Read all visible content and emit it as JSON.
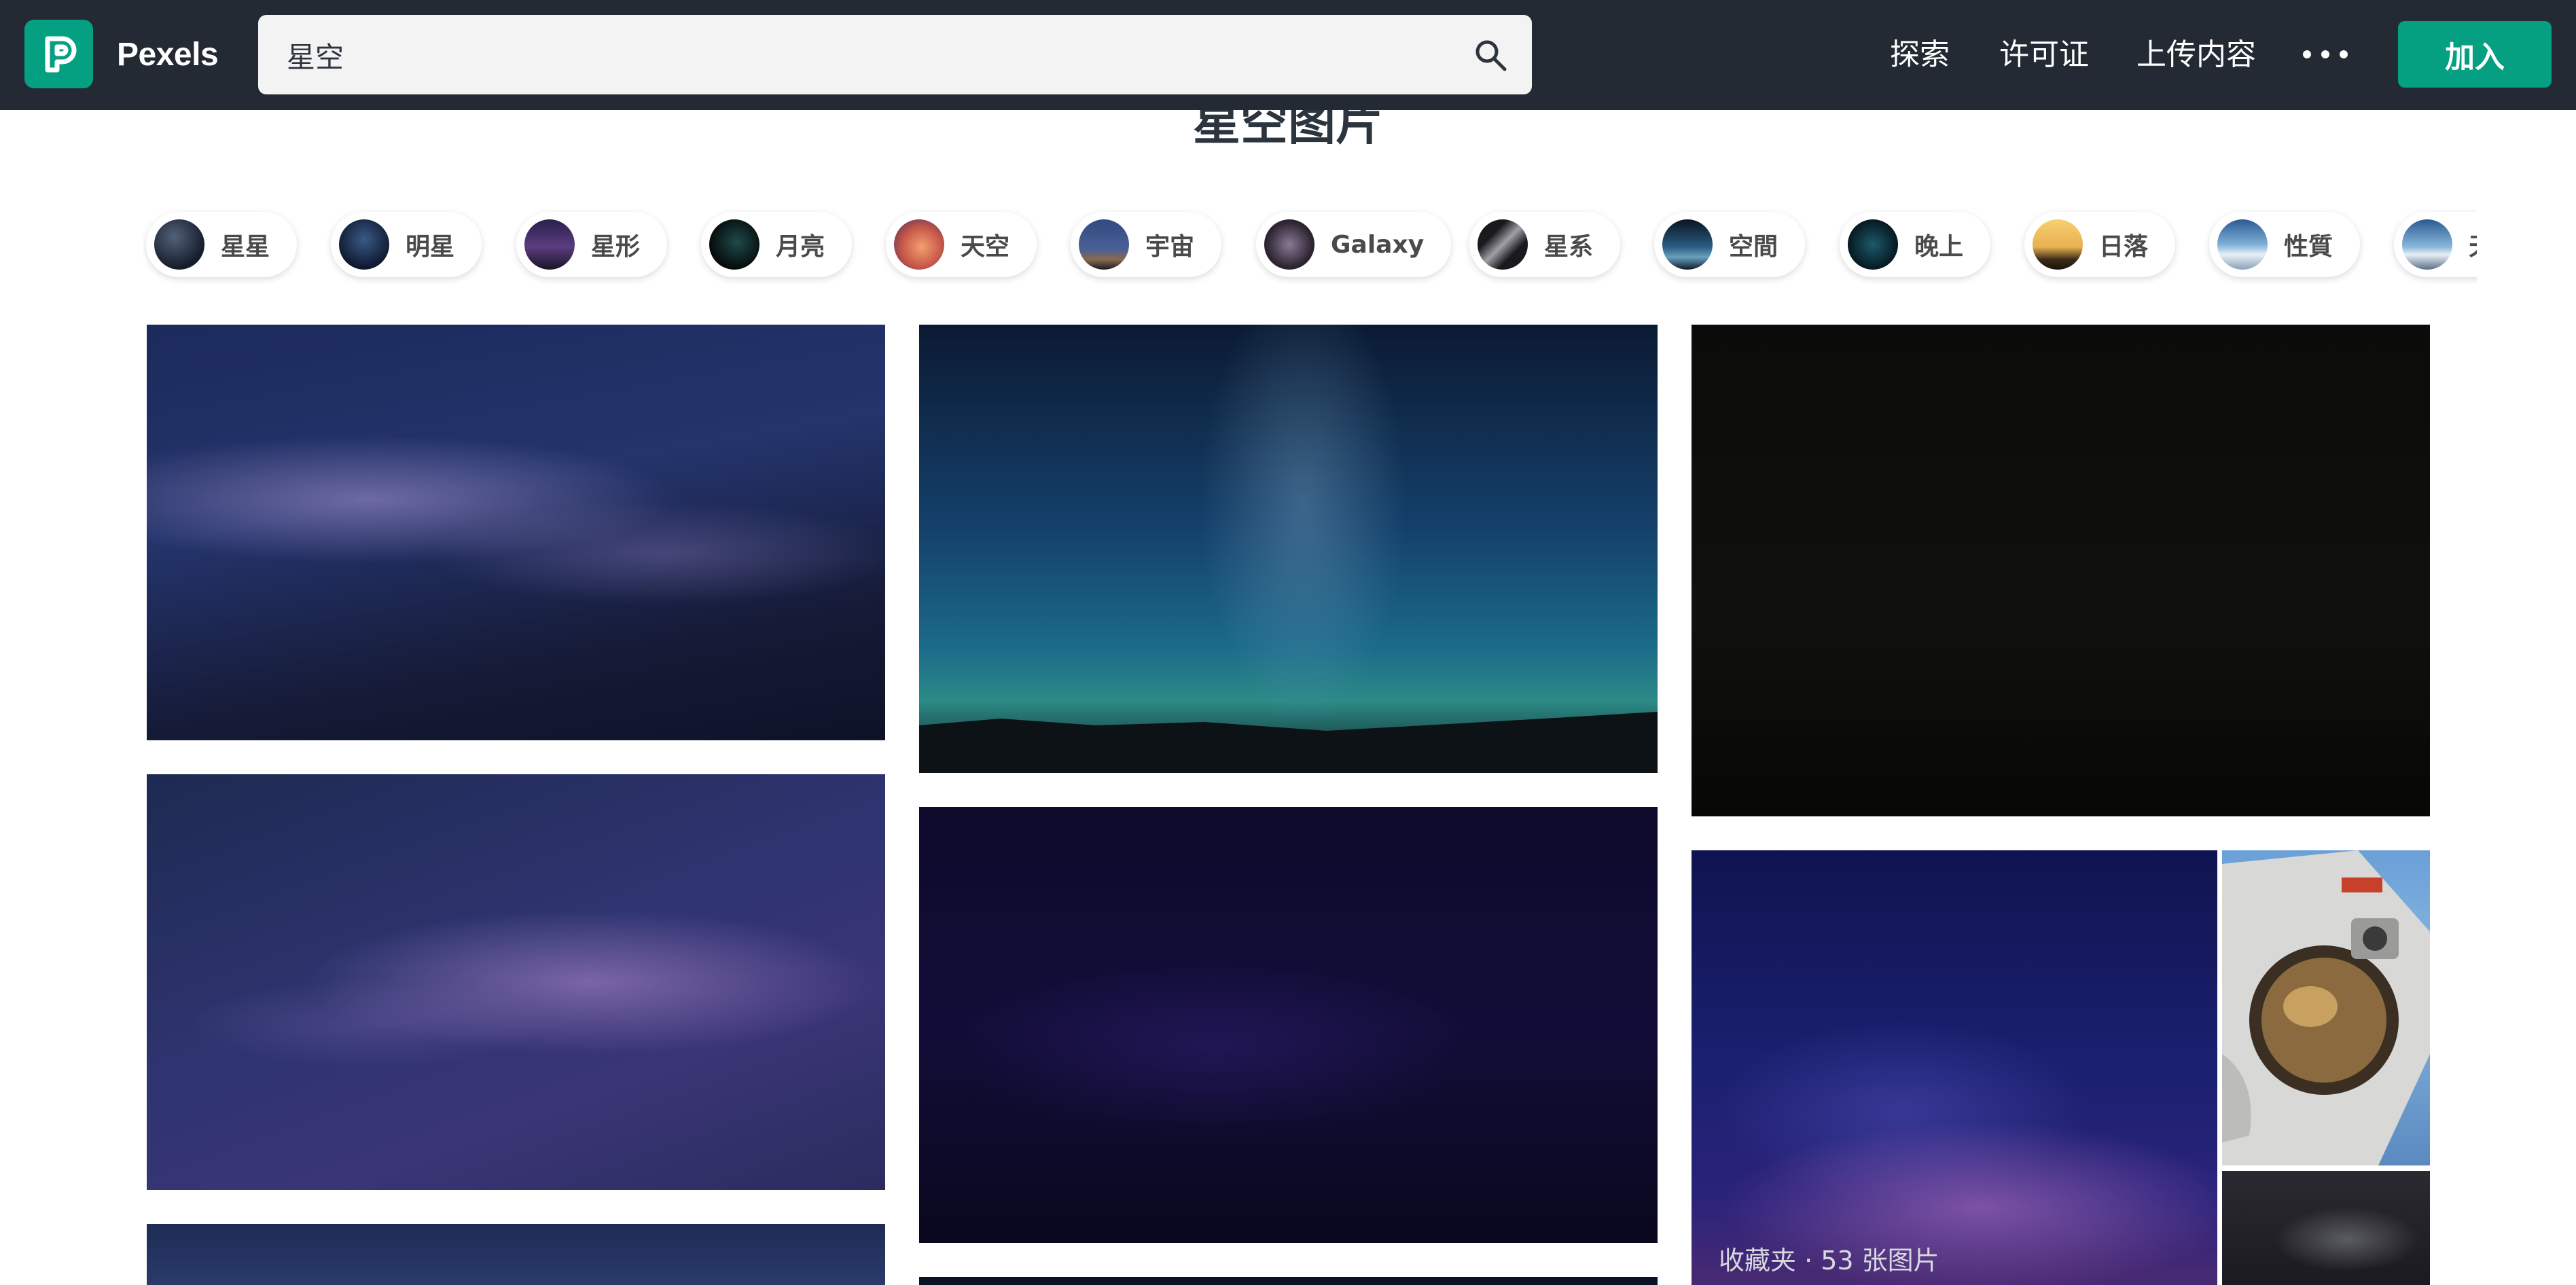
{
  "header": {
    "logo_text": "Pexels",
    "search_value": "星空",
    "nav": [
      {
        "label": "探索"
      },
      {
        "label": "许可证"
      },
      {
        "label": "上传内容"
      }
    ],
    "more_icon": "ellipsis-icon",
    "join_label": "加入"
  },
  "page_title": "星空图片",
  "chips": [
    {
      "label": "星星"
    },
    {
      "label": "明星"
    },
    {
      "label": "星形"
    },
    {
      "label": "月亮"
    },
    {
      "label": "天空"
    },
    {
      "label": "宇宙"
    },
    {
      "label": "Galaxy"
    },
    {
      "label": "星系"
    },
    {
      "label": "空間"
    },
    {
      "label": "晚上"
    },
    {
      "label": "日落"
    },
    {
      "label": "性質"
    },
    {
      "label": "天"
    }
  ],
  "collection": {
    "caption": "收藏夹 · 53 张图片"
  },
  "colors": {
    "header_bg": "#232a34",
    "brand": "#05a081",
    "search_bg": "#f3f3f3"
  }
}
